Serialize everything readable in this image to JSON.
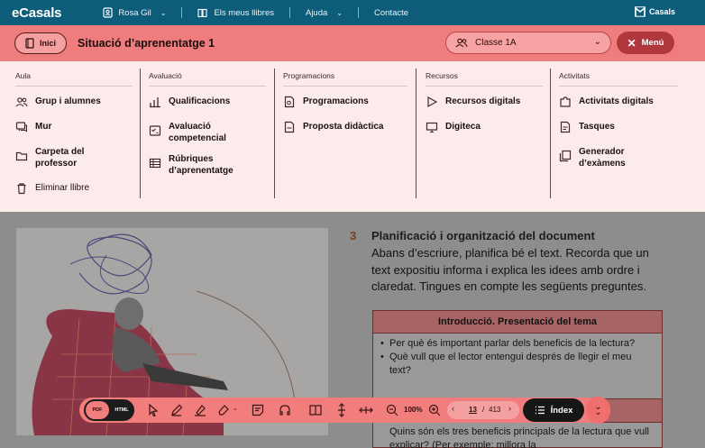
{
  "topnav": {
    "brand": "eCasals",
    "user": "Rosa Gil",
    "books": "Els meus llibres",
    "help": "Ajuda",
    "contact": "Contacte",
    "brand_right": "Casals"
  },
  "header": {
    "home_label": "Inici",
    "section_title": "Situació d’aprenentatge 1",
    "class_value": "Classe 1A",
    "menu_label": "Menú"
  },
  "mega_menu": {
    "aula": {
      "heading": "Aula",
      "items": [
        "Grup i alumnes",
        "Mur",
        "Carpeta del professor",
        "Eliminar llibre"
      ]
    },
    "avaluacio": {
      "heading": "Avaluació",
      "items": [
        "Qualificacions",
        "Avaluació competencial",
        "Rúbriques d’aprenentatge"
      ]
    },
    "programacions": {
      "heading": "Programacions",
      "items": [
        "Programacions",
        "Proposta didàctica"
      ]
    },
    "recursos": {
      "heading": "Recursos",
      "items": [
        "Recursos digitals",
        "Digiteca"
      ]
    },
    "activitats": {
      "heading": "Activitats",
      "items": [
        "Activitats digitals",
        "Tasques",
        "Generador d’exàmens"
      ]
    }
  },
  "document": {
    "step_number": "3",
    "step_title": "Planificació i organització del document",
    "step_body": "Abans d’escriure, planifica bé el text. Recorda que un text expositiu informa i explica les idees amb ordre i claredat. Tingues en compte les següents preguntes.",
    "table_header": "Introducció. Presentació del tema",
    "table_items": [
      "Per què és important parlar dels beneficis de la lectura?",
      "Què vull que el lector entengui després de llegir el meu text?"
    ],
    "table_items_2": [
      "Quins són els tres beneficis principals de la lectura que vull explicar? (Per exemple: millora la"
    ]
  },
  "toolbar": {
    "pdf_label": "PDF",
    "html_label": "HTML",
    "zoom": "100%",
    "page_current": "13",
    "page_separator": "/",
    "page_total": "413",
    "index_label": "Índex"
  },
  "colors": {
    "topnav": "#0d5c7a",
    "header": "#ef7d7d",
    "menu_button": "#b0383d",
    "mega_bg": "#fcebeb",
    "toolbar": "#f27d7d"
  }
}
